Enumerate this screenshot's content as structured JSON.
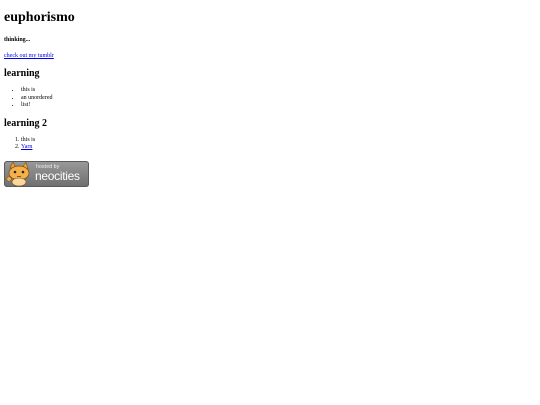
{
  "site": {
    "title": "euphorismo",
    "subtitle": "thinking...",
    "link_text": "check out my tumblr"
  },
  "section1": {
    "heading": "learning",
    "items": [
      "this is",
      "an unordered",
      "list!"
    ]
  },
  "section2": {
    "heading": "learning 2",
    "items": [
      "this is",
      "Yarn"
    ]
  },
  "badge": {
    "hosted_by": "hosted by",
    "brand": "neocities",
    "icon": "neocities-cat-icon"
  },
  "colors": {
    "link": "#0000ee",
    "badge_bg": "#7d7d7d",
    "cat_orange": "#f2a33a"
  }
}
